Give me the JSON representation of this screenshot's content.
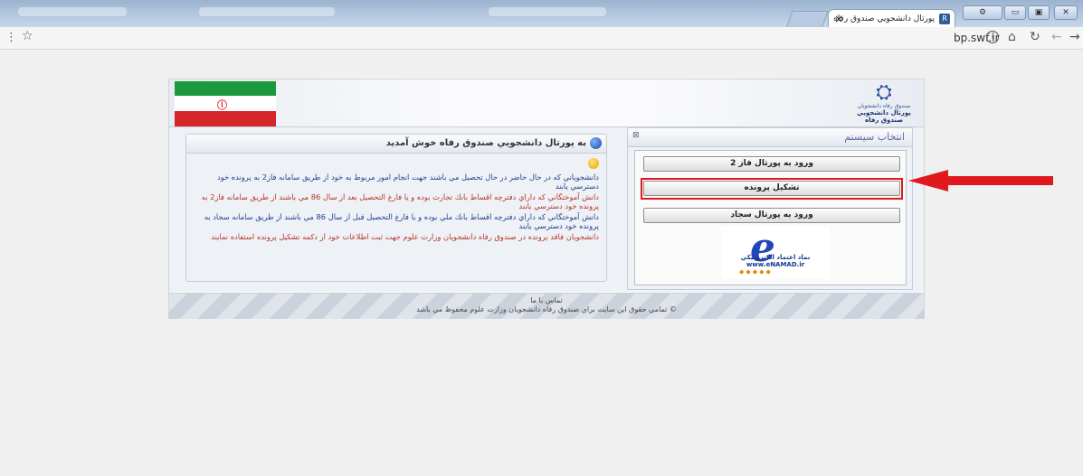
{
  "browser": {
    "tab_title": "پورتال دانشجويي صندوق رفاه",
    "url": "bp.swf.ir",
    "star": "☆",
    "menu": "⋮"
  },
  "header": {
    "logo_org": "صندوق رفاه دانشجويان",
    "logo_name": "پورتال دانشجويي صندوق رفاه"
  },
  "welcome": {
    "title": "به پورتال دانشجويي صندوق رفاه خوش آمديد",
    "paragraphs": [
      {
        "text": "دانشجوياني كه در حال حاضر در حال تحصيل مي باشند جهت انجام امور مربوط به خود از طريق سامانه فاز2 به پرونده خود دسترسي يابند",
        "color": "#1f3f8f"
      },
      {
        "text": "دانش آموختگاني كه داراي دفترچه اقساط بانك تجارت بوده و يا فارغ التحصيل بعد از سال 86 مي باشند از طريق سامانه فاز2 به پرونده خود دسترسي يابند",
        "color": "#b5352a"
      },
      {
        "text": "دانش آموختگاني كه داراي دفترچه اقساط بانك ملي بوده و يا فارغ التحصيل قبل از سال 86 مي باشند از طريق سامانه سجاد به پرونده خود دسترسي يابند",
        "color": "#1f3f8f"
      },
      {
        "text": "دانشجويان فاقد پرونده در صندوق رفاه دانشجويان وزارت علوم جهت ثبت اطلاعات خود از دكمه تشكيل پرونده استفاده نمايند",
        "color": "#b5352a"
      }
    ]
  },
  "system_panel": {
    "title": "انتخاب سيستم",
    "buttons": [
      "ورود به پورتال فاز 2",
      "تشكيل پرونده",
      "ورود به پورتال سجاد"
    ],
    "enamad_text": "نماد اعتماد الكترونيكي",
    "enamad_url": "www.eNAMAD.ir"
  },
  "footer": {
    "contact": "تماس با ما",
    "copyright": "© تمامي حقوق اين سايت براي صندوق رفاه دانشجويان وزارت علوم محفوظ مي باشد"
  },
  "colors": {
    "highlight": "#e0191f",
    "arrow": "#e0191f"
  }
}
